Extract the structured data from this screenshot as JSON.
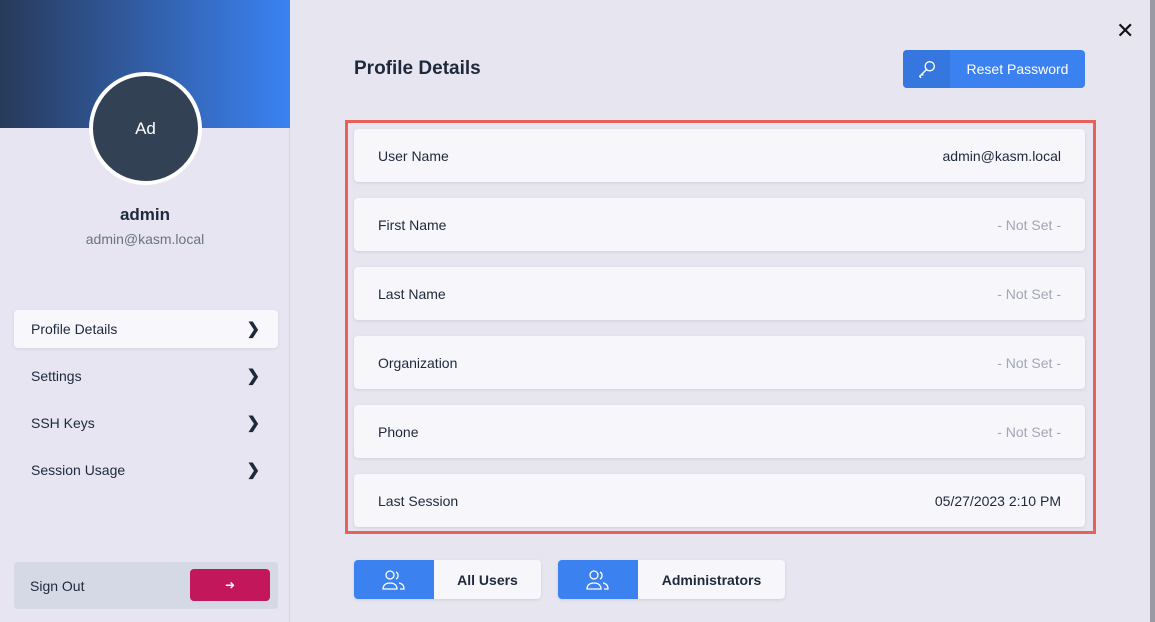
{
  "sidebar": {
    "avatar_initials": "Ad",
    "name": "admin",
    "email": "admin@kasm.local",
    "items": [
      {
        "label": "Profile Details",
        "active": true
      },
      {
        "label": "Settings"
      },
      {
        "label": "SSH Keys"
      },
      {
        "label": "Session Usage"
      }
    ],
    "sign_out_label": "Sign Out",
    "sign_out_color": "#c2185b"
  },
  "main": {
    "title": "Profile Details",
    "reset_password_label": "Reset Password",
    "accent": "#3b82f0",
    "fields": [
      {
        "label": "User Name",
        "value": "admin@kasm.local"
      },
      {
        "label": "First Name",
        "value": "- Not Set -"
      },
      {
        "label": "Last Name",
        "value": "- Not Set -"
      },
      {
        "label": "Organization",
        "value": "- Not Set -"
      },
      {
        "label": "Phone",
        "value": "- Not Set -"
      },
      {
        "label": "Last Session",
        "value": "05/27/2023 2:10 PM"
      }
    ],
    "groups": [
      {
        "label": "All Users"
      },
      {
        "label": "Administrators"
      }
    ]
  }
}
